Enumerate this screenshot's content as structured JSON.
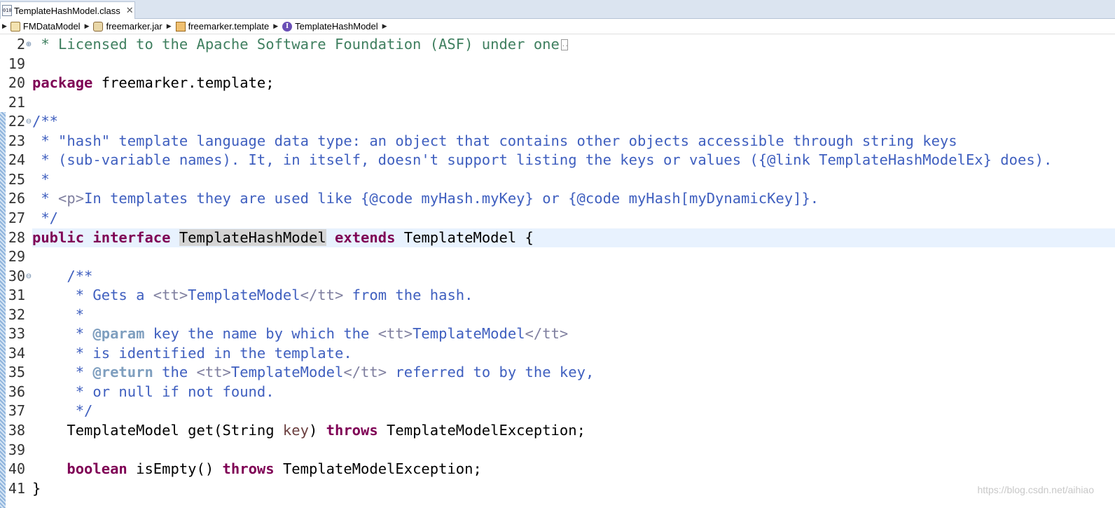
{
  "tab": {
    "title": "TemplateHashModel.class",
    "icon": "class-file-icon",
    "close_symbol": "✕"
  },
  "breadcrumb": [
    {
      "label": "FMDataModel",
      "icon": "project-icon"
    },
    {
      "label": "freemarker.jar",
      "icon": "jar-icon"
    },
    {
      "label": "freemarker.template",
      "icon": "package-icon"
    },
    {
      "label": "TemplateHashModel",
      "icon": "interface-icon",
      "icon_glyph": "I"
    }
  ],
  "colors": {
    "keyword": "#7f0055",
    "comment": "#3f7f5f",
    "javadoc": "#3f5fbf",
    "javadoc_tag": "#7f9fbf",
    "current_line": "#e8f2fe"
  },
  "editor": {
    "lines": [
      {
        "no": "2",
        "fold": "⊕",
        "segments": [
          {
            "t": " * Licensed to the Apache Software Foundation (ASF) under one",
            "c": "cm"
          }
        ],
        "collapsed": true
      },
      {
        "no": "19",
        "segments": []
      },
      {
        "no": "20",
        "segments": [
          {
            "t": "package",
            "c": "kw"
          },
          {
            "t": " freemarker.template;",
            "c": ""
          }
        ]
      },
      {
        "no": "21",
        "segments": []
      },
      {
        "no": "22",
        "fold": "⊖",
        "segments": [
          {
            "t": "/**",
            "c": "jd"
          }
        ]
      },
      {
        "no": "23",
        "segments": [
          {
            "t": " * \"hash\" template language data type: an object that contains other objects accessible through string keys",
            "c": "jd"
          }
        ]
      },
      {
        "no": "24",
        "segments": [
          {
            "t": " * (sub-variable names). It, in itself, doesn't support listing the keys or values ({@link TemplateHashModelEx} does).",
            "c": "jd"
          }
        ]
      },
      {
        "no": "25",
        "segments": [
          {
            "t": " *",
            "c": "jd"
          }
        ]
      },
      {
        "no": "26",
        "segments": [
          {
            "t": " * ",
            "c": "jd"
          },
          {
            "t": "<p>",
            "c": "jdhtml"
          },
          {
            "t": "In templates they are used like {@code myHash.myKey} or {@code myHash[myDynamicKey]}.",
            "c": "jd"
          }
        ]
      },
      {
        "no": "27",
        "segments": [
          {
            "t": " */",
            "c": "jd"
          }
        ]
      },
      {
        "no": "28",
        "current": true,
        "segments": [
          {
            "t": "public",
            "c": "kw"
          },
          {
            "t": " ",
            "c": ""
          },
          {
            "t": "interface",
            "c": "kw"
          },
          {
            "t": " ",
            "c": ""
          },
          {
            "t": "TemplateHashModel",
            "c": "hl"
          },
          {
            "t": " ",
            "c": ""
          },
          {
            "t": "extends",
            "c": "kw"
          },
          {
            "t": " TemplateModel {",
            "c": ""
          }
        ]
      },
      {
        "no": "29",
        "segments": []
      },
      {
        "no": "30",
        "fold": "⊖",
        "segments": [
          {
            "t": "    /**",
            "c": "jd"
          }
        ]
      },
      {
        "no": "31",
        "segments": [
          {
            "t": "     * Gets a ",
            "c": "jd"
          },
          {
            "t": "<tt>",
            "c": "jdhtml"
          },
          {
            "t": "TemplateModel",
            "c": "jd"
          },
          {
            "t": "</tt>",
            "c": "jdhtml"
          },
          {
            "t": " from the hash.",
            "c": "jd"
          }
        ]
      },
      {
        "no": "32",
        "segments": [
          {
            "t": "     *",
            "c": "jd"
          }
        ]
      },
      {
        "no": "33",
        "segments": [
          {
            "t": "     * ",
            "c": "jd"
          },
          {
            "t": "@param",
            "c": "jdtag"
          },
          {
            "t": " key the name by which the ",
            "c": "jd"
          },
          {
            "t": "<tt>",
            "c": "jdhtml"
          },
          {
            "t": "TemplateModel",
            "c": "jd"
          },
          {
            "t": "</tt>",
            "c": "jdhtml"
          }
        ]
      },
      {
        "no": "34",
        "segments": [
          {
            "t": "     * is identified in the template.",
            "c": "jd"
          }
        ]
      },
      {
        "no": "35",
        "segments": [
          {
            "t": "     * ",
            "c": "jd"
          },
          {
            "t": "@return",
            "c": "jdtag"
          },
          {
            "t": " the ",
            "c": "jd"
          },
          {
            "t": "<tt>",
            "c": "jdhtml"
          },
          {
            "t": "TemplateModel",
            "c": "jd"
          },
          {
            "t": "</tt>",
            "c": "jdhtml"
          },
          {
            "t": " referred to by the key,",
            "c": "jd"
          }
        ]
      },
      {
        "no": "36",
        "segments": [
          {
            "t": "     * or null if not found.",
            "c": "jd"
          }
        ]
      },
      {
        "no": "37",
        "segments": [
          {
            "t": "     */",
            "c": "jd"
          }
        ]
      },
      {
        "no": "38",
        "segments": [
          {
            "t": "    TemplateModel get(String ",
            "c": ""
          },
          {
            "t": "key",
            "c": "var"
          },
          {
            "t": ") ",
            "c": ""
          },
          {
            "t": "throws",
            "c": "kw"
          },
          {
            "t": " TemplateModelException;",
            "c": ""
          }
        ]
      },
      {
        "no": "39",
        "segments": []
      },
      {
        "no": "40",
        "segments": [
          {
            "t": "    ",
            "c": ""
          },
          {
            "t": "boolean",
            "c": "kw"
          },
          {
            "t": " isEmpty() ",
            "c": ""
          },
          {
            "t": "throws",
            "c": "kw"
          },
          {
            "t": " TemplateModelException;",
            "c": ""
          }
        ]
      },
      {
        "no": "41",
        "segments": [
          {
            "t": "}",
            "c": ""
          }
        ]
      }
    ]
  },
  "watermark": "https://blog.csdn.net/aihiao"
}
